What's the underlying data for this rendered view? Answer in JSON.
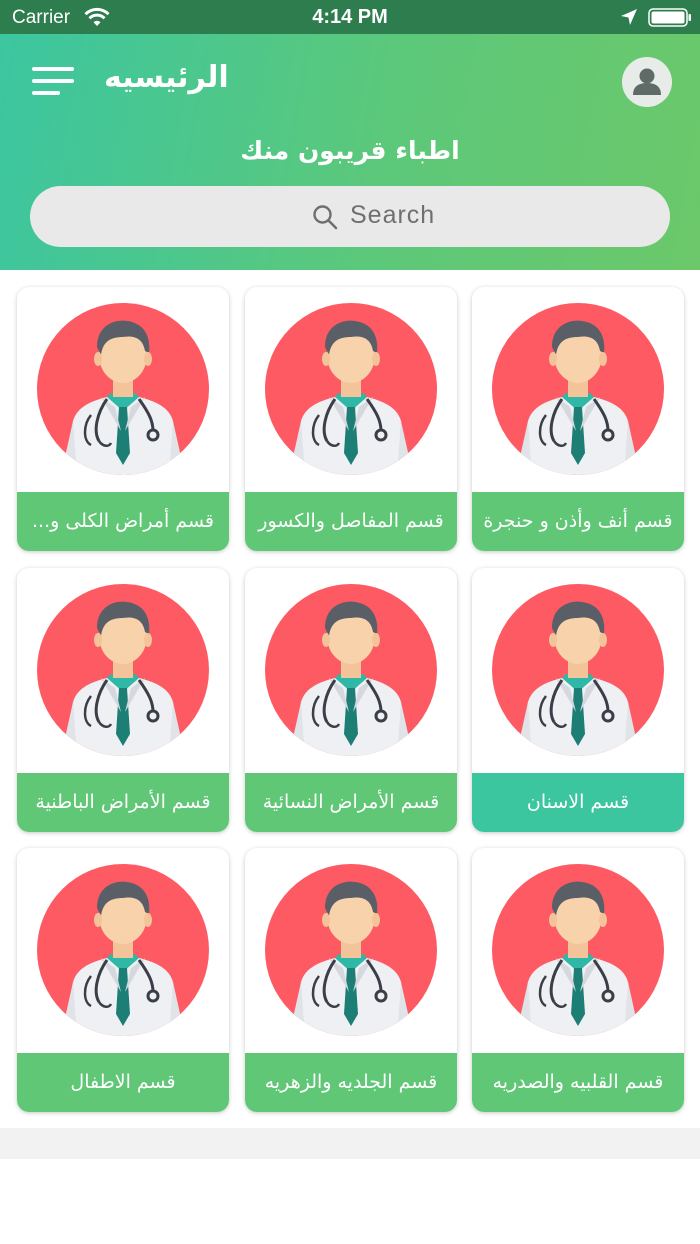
{
  "status_bar": {
    "carrier": "Carrier",
    "time": "4:14 PM"
  },
  "header": {
    "title": "الرئيسيه",
    "subtitle": "اطباء قريبون منك",
    "search_placeholder": "Search"
  },
  "colors": {
    "green_label": "#5fc776",
    "teal_label": "#3cc6a0",
    "circle_red": "#fd5a63"
  },
  "departments": [
    {
      "label": "قسم أنف وأذن و حنجرة",
      "color": "green",
      "icon": "doctor-icon"
    },
    {
      "label": "قسم  المفاصل والكسور",
      "color": "green",
      "icon": "doctor-icon"
    },
    {
      "label": "قسم  أمراض الكلى و...",
      "color": "green",
      "icon": "doctor-icon"
    },
    {
      "label": "قسم الاسنان",
      "color": "teal",
      "icon": "doctor-icon"
    },
    {
      "label": "قسم الأمراض النسائية",
      "color": "green",
      "icon": "doctor-icon"
    },
    {
      "label": "قسم الأمراض الباطنية",
      "color": "green",
      "icon": "doctor-icon"
    },
    {
      "label": "قسم القلبيه والصدريه",
      "color": "green",
      "icon": "doctor-icon"
    },
    {
      "label": "قسم الجلديه والزهريه",
      "color": "green",
      "icon": "doctor-icon"
    },
    {
      "label": "قسم الاطفال",
      "color": "green",
      "icon": "doctor-icon"
    }
  ]
}
